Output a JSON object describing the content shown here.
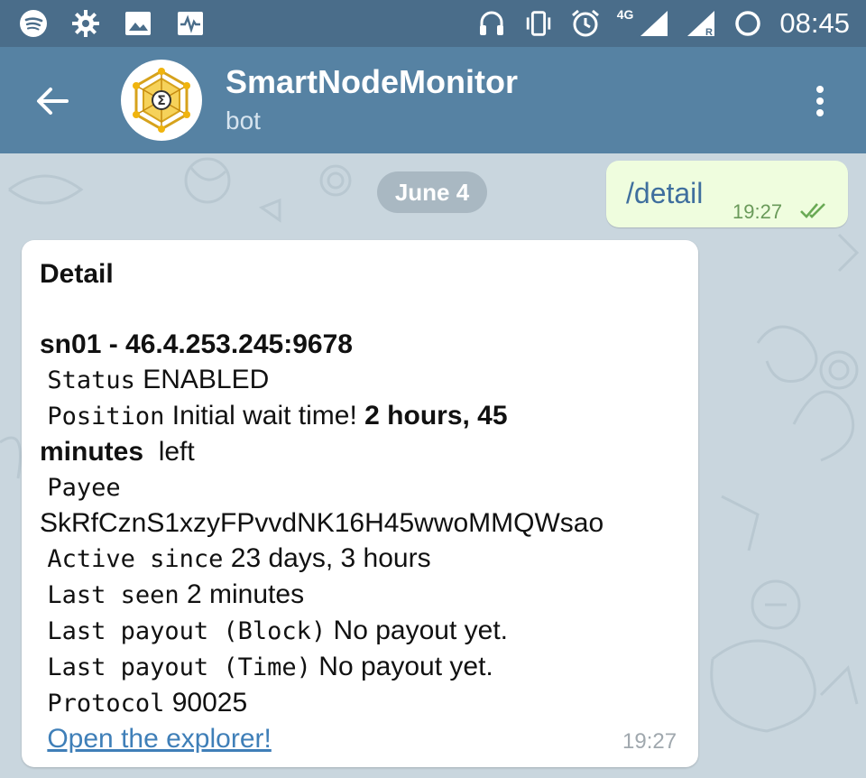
{
  "status_bar": {
    "time": "08:45",
    "network_type": "4G",
    "left_icons": [
      "spotify-icon",
      "settings-gear-icon",
      "image-icon",
      "activity-icon"
    ],
    "right_icons": [
      "headset-icon",
      "vibrate-icon",
      "alarm-icon",
      "signal-4g-icon",
      "signal-roaming-icon",
      "loading-icon"
    ]
  },
  "header": {
    "title": "SmartNodeMonitor",
    "subtitle": "bot",
    "colors": {
      "status_bar": "#4a6d8a",
      "header": "#5682a3"
    }
  },
  "chat": {
    "date_label": "June 4",
    "outgoing": {
      "text": "/detail",
      "time": "19:27",
      "status": "read"
    },
    "incoming": {
      "heading": "Detail",
      "node_title": "sn01 - 46.4.253.245:9678",
      "status_label": "Status",
      "status_value": "ENABLED",
      "position_label": "Position",
      "position_text": "Initial wait time!",
      "position_time_bold": "2 hours, 45",
      "position_time_bold_2": "minutes",
      "position_suffix": "left",
      "payee_label": "Payee",
      "payee_value": "SkRfCznS1xzyFPvvdNK16H45wwoMMQWsao",
      "active_label": "Active since",
      "active_value": "23 days, 3 hours",
      "last_seen_label": "Last seen",
      "last_seen_value": "2 minutes",
      "payout_block_label": "Last payout (Block)",
      "payout_block_value": "No payout yet.",
      "payout_time_label": "Last payout (Time)",
      "payout_time_value": "No payout yet.",
      "protocol_label": "Protocol",
      "protocol_value": "90025",
      "link_text": "Open the explorer!",
      "time": "19:27"
    }
  }
}
